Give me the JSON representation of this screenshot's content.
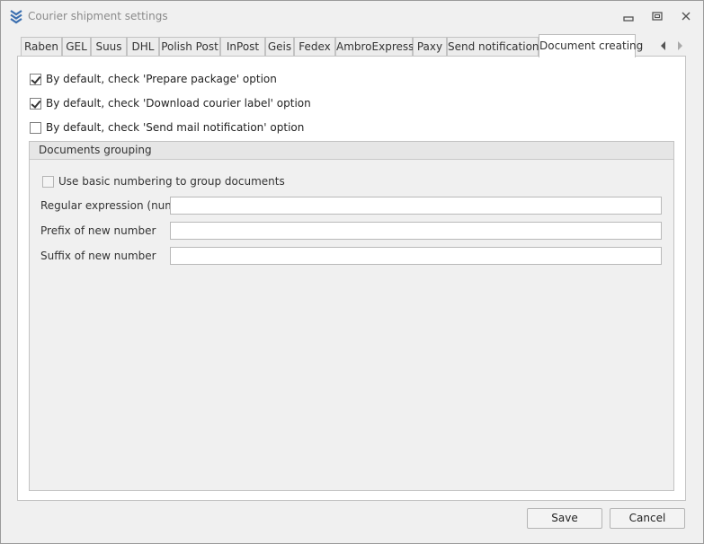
{
  "window": {
    "title": "Courier shipment settings",
    "icon": "stacked-chevrons-icon",
    "accent": "#3b6fb0"
  },
  "tabs": [
    {
      "label": "Raben"
    },
    {
      "label": "GEL"
    },
    {
      "label": "Suus"
    },
    {
      "label": "DHL"
    },
    {
      "label": "Polish Post"
    },
    {
      "label": "InPost"
    },
    {
      "label": "Geis"
    },
    {
      "label": "Fedex"
    },
    {
      "label": "AmbroExpress"
    },
    {
      "label": "Paxy"
    },
    {
      "label": "Send notifications"
    },
    {
      "label": "Document creating",
      "active": true
    }
  ],
  "options": {
    "prepare_package": {
      "label": "By default, check 'Prepare package' option",
      "checked": true
    },
    "download_label": {
      "label": "By default, check 'Download courier label' option",
      "checked": true
    },
    "send_mail": {
      "label": "By default, check 'Send mail notification' option",
      "checked": false
    }
  },
  "grouping": {
    "title": "Documents grouping",
    "basic_numbering": {
      "label": "Use basic numbering to group documents",
      "checked": false,
      "enabled": false
    },
    "regex": {
      "label": "Regular expression (number)",
      "value": ""
    },
    "prefix": {
      "label": "Prefix of new number",
      "value": ""
    },
    "suffix": {
      "label": "Suffix of new number",
      "value": ""
    }
  },
  "footer": {
    "save_label": "Save",
    "cancel_label": "Cancel"
  }
}
